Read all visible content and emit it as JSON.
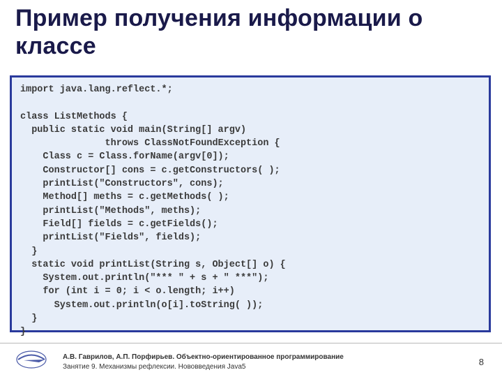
{
  "heading": "Пример получения информации о классе",
  "code": "import java.lang.reflect.*;\n\nclass ListMethods {\n  public static void main(String[] argv)\n               throws ClassNotFoundException {\n    Class c = Class.forName(argv[0]);\n    Constructor[] cons = c.getConstructors( );\n    printList(\"Constructors\", cons);\n    Method[] meths = c.getMethods( );\n    printList(\"Methods\", meths);\n    Field[] fields = c.getFields();\n    printList(\"Fields\", fields);\n  }\n  static void printList(String s, Object[] o) {\n    System.out.println(\"*** \" + s + \" ***\");\n    for (int i = 0; i < o.length; i++)\n      System.out.println(o[i].toString( ));\n  }\n}",
  "footer": {
    "line1": "А.В. Гаврилов, А.П. Порфирьев. Объектно-ориентированное программирование",
    "line2": "Занятие 9. Механизмы рефлексии. Нововведения Java5"
  },
  "page_number": "8"
}
